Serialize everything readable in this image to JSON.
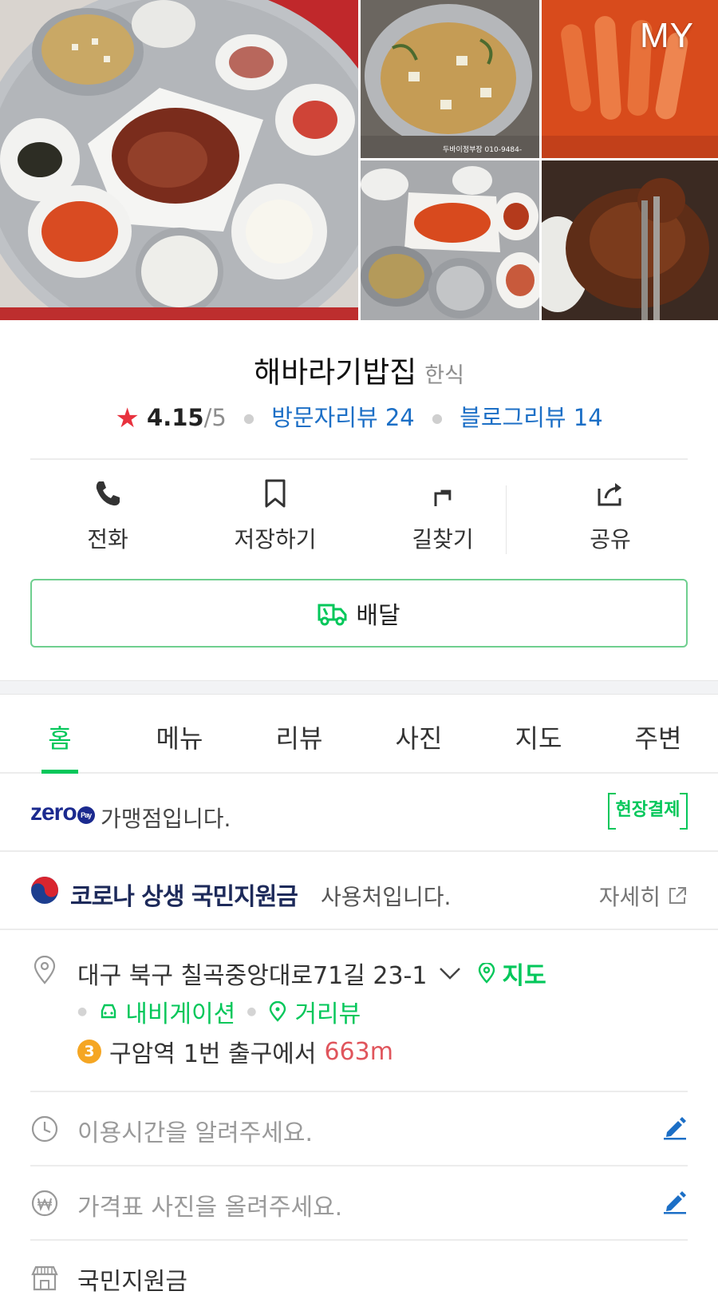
{
  "gallery": {
    "my_label": "MY",
    "caption": "두바이정부장 010-9484-"
  },
  "place": {
    "name": "해바라기밥집",
    "category": "한식",
    "rating": "4.15",
    "rating_max": "/5",
    "visitor_reviews": "방문자리뷰 24",
    "blog_reviews": "블로그리뷰 14"
  },
  "actions": [
    {
      "label": "전화",
      "icon": "phone-icon"
    },
    {
      "label": "저장하기",
      "icon": "bookmark-icon"
    },
    {
      "label": "길찾기",
      "icon": "directions-icon"
    },
    {
      "label": "공유",
      "icon": "share-icon"
    }
  ],
  "delivery": {
    "label": "배달",
    "icon": "delivery-truck-icon"
  },
  "tabs": [
    "홈",
    "메뉴",
    "리뷰",
    "사진",
    "지도",
    "주변"
  ],
  "active_tab": "홈",
  "zeropay": {
    "logo": "zero",
    "logo_sub": "Pay",
    "text": "가맹점입니다.",
    "badge": "현장결제"
  },
  "corona": {
    "name": "코로나 상생 국민지원금",
    "text": "사용처입니다.",
    "detail": "자세히"
  },
  "address": {
    "text": "대구 북구 칠곡중앙대로71길 23-1",
    "map_link": "지도",
    "navigation": "내비게이션",
    "street_view": "거리뷰",
    "subway_line": "3",
    "station": "구암역",
    "exit_text": "1번 출구에서",
    "distance": "663m"
  },
  "hours_prompt": "이용시간을 알려주세요.",
  "price_prompt": "가격표 사진을 올려주세요.",
  "support_fund": "국민지원금",
  "colors": {
    "accent": "#03c75a",
    "link": "#1c6fc6",
    "star": "#e8323e",
    "distance": "#e0555c",
    "line3": "#f5a623"
  }
}
